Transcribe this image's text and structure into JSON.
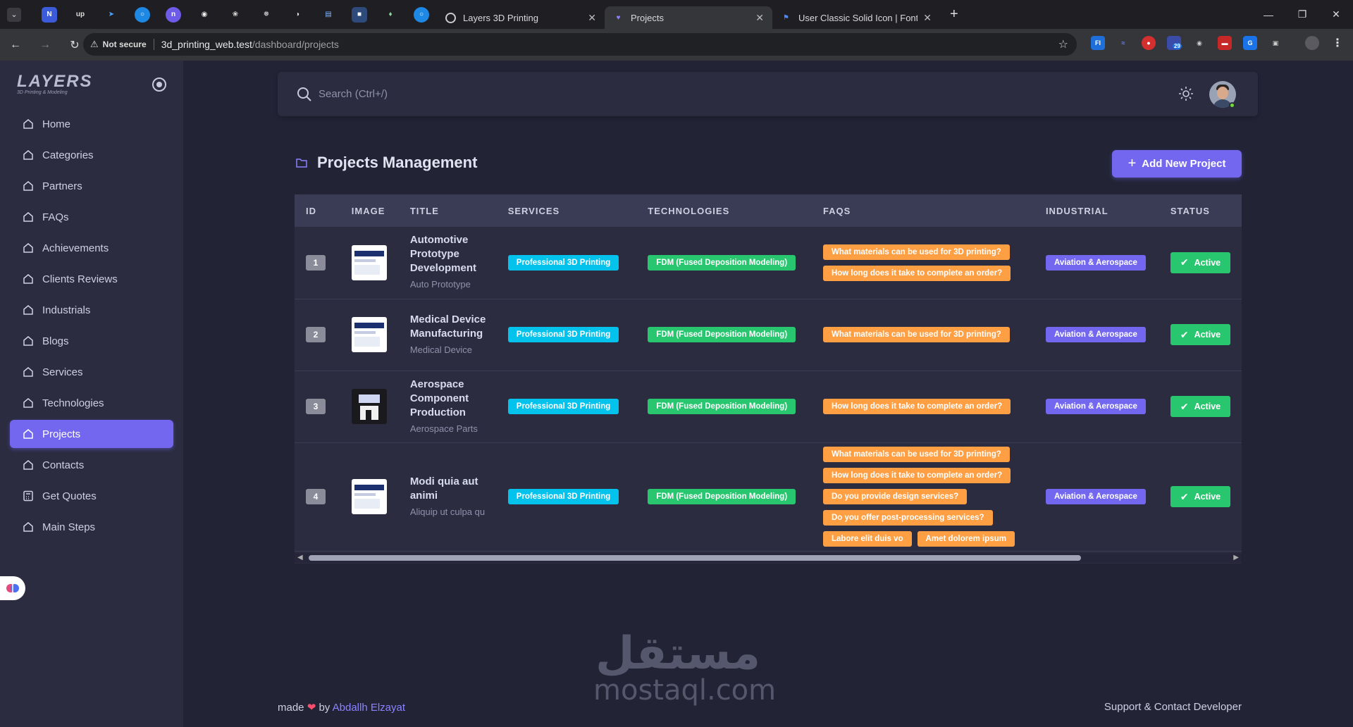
{
  "browser": {
    "tabs": [
      {
        "title": "Layers 3D Printing",
        "active": false
      },
      {
        "title": "Projects",
        "active": true
      },
      {
        "title": "User Classic Solid Icon | Font Av",
        "active": false
      }
    ],
    "address": {
      "warning": "Not secure",
      "host": "3d_printing_web.test",
      "path": "/dashboard/projects"
    },
    "ext_badge": "29"
  },
  "sidebar": {
    "logo_text": "LAYERS",
    "logo_tagline": "3D Printing & Modeling",
    "items": [
      {
        "label": "Home",
        "icon": "home-icon"
      },
      {
        "label": "Categories",
        "icon": "home-icon"
      },
      {
        "label": "Partners",
        "icon": "home-icon"
      },
      {
        "label": "FAQs",
        "icon": "home-icon"
      },
      {
        "label": "Achievements",
        "icon": "home-icon"
      },
      {
        "label": "Clients Reviews",
        "icon": "home-icon"
      },
      {
        "label": "Industrials",
        "icon": "home-icon"
      },
      {
        "label": "Blogs",
        "icon": "home-icon"
      },
      {
        "label": "Services",
        "icon": "home-icon"
      },
      {
        "label": "Technologies",
        "icon": "home-icon"
      },
      {
        "label": "Projects",
        "icon": "home-icon",
        "active": true
      },
      {
        "label": "Contacts",
        "icon": "home-icon"
      },
      {
        "label": "Get Quotes",
        "icon": "calculator-icon"
      },
      {
        "label": "Main Steps",
        "icon": "home-icon"
      }
    ]
  },
  "topbar": {
    "search_placeholder": "Search (Ctrl+/)"
  },
  "page": {
    "title": "Projects Management",
    "add_button": "Add New Project"
  },
  "table": {
    "headers": [
      "ID",
      "IMAGE",
      "TITLE",
      "SERVICES",
      "TECHNOLOGIES",
      "FAQS",
      "INDUSTRIAL",
      "STATUS"
    ],
    "rows": [
      {
        "id": "1",
        "title": "Automotive Prototype Development",
        "subtitle": "Auto Prototype",
        "service": "Professional 3D Printing",
        "technology": "FDM (Fused Deposition Modeling)",
        "faqs": [
          "What materials can be used for 3D printing?",
          "How long does it take to complete an order?"
        ],
        "industrial": "Aviation & Aerospace",
        "status": "Active"
      },
      {
        "id": "2",
        "title": "Medical Device Manufacturing",
        "subtitle": "Medical Device",
        "service": "Professional 3D Printing",
        "technology": "FDM (Fused Deposition Modeling)",
        "faqs": [
          "What materials can be used for 3D printing?"
        ],
        "industrial": "Aviation & Aerospace",
        "status": "Active"
      },
      {
        "id": "3",
        "title": "Aerospace Component Production",
        "subtitle": "Aerospace Parts",
        "service": "Professional 3D Printing",
        "technology": "FDM (Fused Deposition Modeling)",
        "faqs": [
          "How long does it take to complete an order?"
        ],
        "industrial": "Aviation & Aerospace",
        "status": "Active"
      },
      {
        "id": "4",
        "title": "Modi quia aut animi",
        "subtitle": "Aliquip ut culpa qu",
        "service": "Professional 3D Printing",
        "technology": "FDM (Fused Deposition Modeling)",
        "faqs": [
          "What materials can be used for 3D printing?",
          "How long does it take to complete an order?",
          "Do you provide design services?",
          "Do you offer post-processing services?",
          "Labore elit duis vo",
          "Amet dolorem ipsum"
        ],
        "industrial": "Aviation & Aerospace",
        "status": "Active"
      }
    ]
  },
  "watermark": {
    "arabic": "مستقل",
    "latin": "mostaql.com"
  },
  "footer": {
    "made": "made",
    "by": "by",
    "author": "Abdallh Elzayat",
    "support": "Support & Contact Developer"
  },
  "colors": {
    "accent": "#7367f0",
    "cyan": "#03c3ec",
    "green": "#28c76f",
    "orange": "#ff9f43",
    "bg": "#222436",
    "panel": "#2b2c40"
  }
}
